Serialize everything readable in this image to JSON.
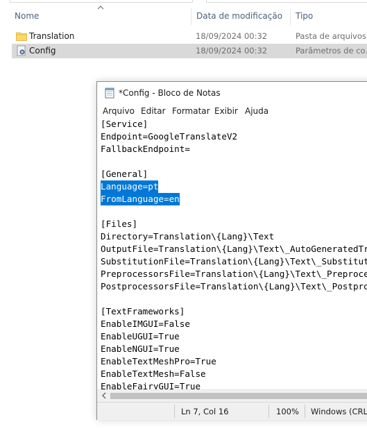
{
  "explorer": {
    "columns": {
      "name": "Nome",
      "date": "Data de modificação",
      "type": "Tipo"
    },
    "rows": [
      {
        "name": "Translation",
        "date": "18/09/2024 00:32",
        "type": "Pasta de arquivos",
        "icon": "folder-icon"
      },
      {
        "name": "Config",
        "date": "18/09/2024 00:32",
        "type": "Parâmetros de co...",
        "icon": "settings-file-icon"
      }
    ]
  },
  "notepad": {
    "title": "*Config - Bloco de Notas",
    "menu": [
      "Arquivo",
      "Editar",
      "Formatar",
      "Exibir",
      "Ajuda"
    ],
    "lines": [
      "[Service]",
      "Endpoint=GoogleTranslateV2",
      "FallbackEndpoint=",
      "",
      "[General]",
      "Language=pt",
      "FromLanguage=en",
      "",
      "[Files]",
      "Directory=Translation\\{Lang}\\Text",
      "OutputFile=Translation\\{Lang}\\Text\\_AutoGeneratedTranslations.txt",
      "SubstitutionFile=Translation\\{Lang}\\Text\\_Substitutions.txt",
      "PreprocessorsFile=Translation\\{Lang}\\Text\\_Preprocessors.txt",
      "PostprocessorsFile=Translation\\{Lang}\\Text\\_Postprocessors.txt",
      "",
      "[TextFrameworks]",
      "EnableIMGUI=False",
      "EnableUGUI=True",
      "EnableNGUI=True",
      "EnableTextMeshPro=True",
      "EnableTextMesh=False",
      "EnableFairyGUI=True"
    ],
    "selected_lines": [
      5,
      6
    ],
    "status": {
      "position": "Ln 7, Col 16",
      "zoom": "100%",
      "encoding": "Windows (CRLF)"
    }
  },
  "colors": {
    "selection": "#0078d7",
    "explorer_selected_row": "#d9d9d9",
    "column_header": "#4c607a"
  }
}
